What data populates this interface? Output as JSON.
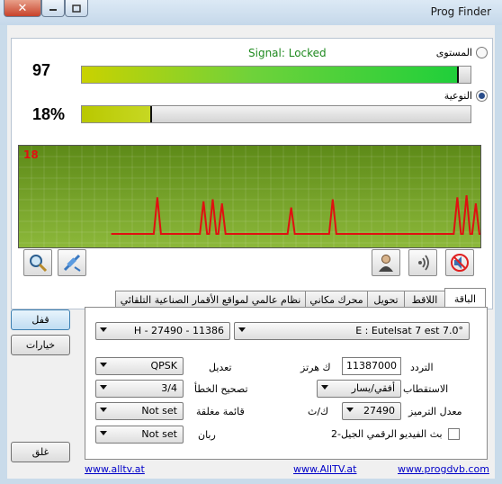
{
  "window": {
    "title": "Prog Finder",
    "close_glyph": "✕"
  },
  "signal": {
    "status": "Signal: Locked",
    "level_label": "المستوى",
    "level_value": "97",
    "level_fraction": 0.97,
    "quality_label": "النوعية",
    "quality_value": "18%",
    "quality_fraction": 0.18,
    "selected": "quality"
  },
  "graph": {
    "current_value": "18",
    "line_color": "#e01010",
    "spike_positions": [
      0.3,
      0.4,
      0.42,
      0.44,
      0.59,
      0.68,
      0.95,
      0.97,
      0.99
    ],
    "spike_heights": [
      0.36,
      0.32,
      0.34,
      0.3,
      0.26,
      0.34,
      0.36,
      0.38,
      0.3
    ]
  },
  "side_buttons": {
    "lock": "قفل",
    "options": "خيارات",
    "close": "غلق"
  },
  "tabs": [
    "الباقة",
    "اللاقط",
    "تحويل",
    "محرك مكاني",
    "نظام عالمي لمواقع الأقمار الصناعية التلقائي"
  ],
  "form": {
    "satellite": "E : Eutelsat 7 est 7.0°",
    "transponder": "H - 27490 - 11386",
    "freq_label": "التردد",
    "freq_value": "11387000",
    "freq_unit": "ك هرتز",
    "mod_label": "تعديل",
    "mod_value": "QPSK",
    "pol_label": "الاستقطاب",
    "pol_value": "أفقي/يسار",
    "fec_label": "تصحيح الخطأ",
    "fec_value": "3/4",
    "sr_label": "معدل الترميز",
    "sr_value": "27490",
    "sr_unit": "ك/ث",
    "closed_list_label": "قائمة مغلقة",
    "closed_list_value": "Not set",
    "dvbs2_label": "بث الفيديو الرقمي الجيل-2",
    "dvbs2_checked": false,
    "ruban_label": "ربان",
    "ruban_value": "Not set"
  },
  "links": [
    "www.alltv.at",
    "www.AllTV.at",
    "www.progdvb.com"
  ],
  "colors": {
    "accent": "#3c7fb1",
    "graph_bg": "#6f9a24"
  }
}
